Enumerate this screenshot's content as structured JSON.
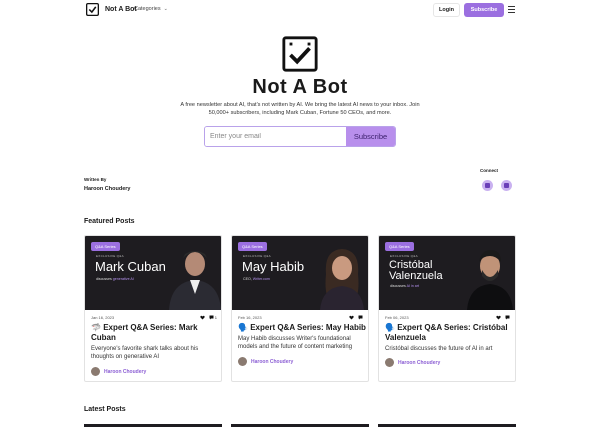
{
  "header": {
    "brand_name": "Not A Bot",
    "categories_label": "Categories",
    "login_label": "Login",
    "subscribe_label": "Subscribe"
  },
  "hero": {
    "title": "Not A Bot",
    "description": "A free newsletter about AI, that's not written by AI. We bring the latest AI news to your inbox. Join 50,000+ subscribers, including Mark Cuban, Fortune 50 CEOs, and more.",
    "email_placeholder": "Enter your email",
    "subscribe_button": "Subscribe"
  },
  "author": {
    "written_by_label": "Written By",
    "name": "Haroon Choudery",
    "connect_label": "Connect"
  },
  "featured": {
    "title": "Featured Posts",
    "cards": [
      {
        "badge": "Q&A Series",
        "exclusive": "EXCLUSIVE Q&A",
        "image_name_line1": "Mark Cuban",
        "image_name_line2": "",
        "image_sub_prefix": "discusses",
        "image_sub_accent": "generative AI",
        "date": "Jan 16, 2023",
        "likes": "",
        "comments": "1",
        "emoji": "🦈",
        "title": "Expert Q&A Series: Mark Cuban",
        "description": "Everyone's favorite shark talks about his thoughts on generative AI",
        "author": "Haroon Choudery"
      },
      {
        "badge": "Q&A Series",
        "exclusive": "EXCLUSIVE Q&A",
        "image_name_line1": "May Habib",
        "image_name_line2": "",
        "image_sub_prefix": "CEO,",
        "image_sub_accent": "Writer.com",
        "date": "Feb 16, 2023",
        "likes": "",
        "comments": "",
        "emoji": "🗣️",
        "title": "Expert Q&A Series: May Habib",
        "description": "May Habib discusses Writer's foundational models and the future of content marketing",
        "author": "Haroon Choudery"
      },
      {
        "badge": "Q&A Series",
        "exclusive": "EXCLUSIVE Q&A",
        "image_name_line1": "Cristóbal",
        "image_name_line2": "Valenzuela",
        "image_sub_prefix": "discusses",
        "image_sub_accent": "AI in art",
        "date": "Feb 06, 2023",
        "likes": "",
        "comments": "",
        "emoji": "🗣️",
        "title": "Expert Q&A Series: Cristóbal Valenzuela",
        "description": "Cristóbal discusses the future of AI in art",
        "author": "Haroon Choudery"
      }
    ]
  },
  "latest": {
    "title": "Latest Posts"
  },
  "colors": {
    "accent": "#9b6fe0",
    "accent_light": "#b88fec",
    "card_image_bg": "#1e1c20"
  },
  "icons": [
    "checkbox-logo-icon",
    "chevron-down-icon",
    "menu-icon",
    "twitter-icon",
    "linkedin-icon",
    "heart-icon",
    "comment-icon"
  ]
}
